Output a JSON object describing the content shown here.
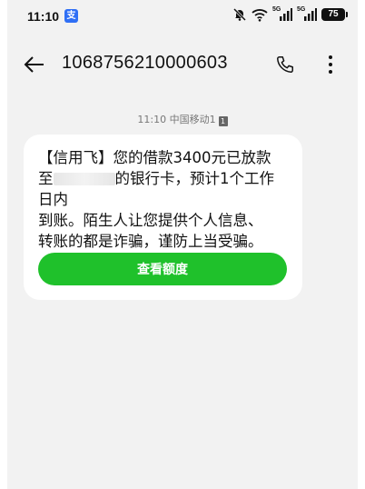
{
  "status_bar": {
    "time": "11:10",
    "app_badge": "支",
    "signal_tag_1": "5G",
    "signal_tag_2": "5G",
    "battery": "75"
  },
  "header": {
    "title": "1068756210000603"
  },
  "conversation": {
    "meta_time": "11:10 中国移动1",
    "sim_badge": "1",
    "message": {
      "line1": "【信用飞】您的借款3400元已放款",
      "line2_prefix": "至",
      "line2_suffix": "的银行卡，预计1个工作日内",
      "line3": "到账。陌生人让您提供个人信息、",
      "line4": "转账的都是诈骗，谨防上当受骗。",
      "button_label": "查看额度"
    }
  },
  "colors": {
    "background": "#f2f2f2",
    "bubble": "#ffffff",
    "button": "#1fc12b"
  },
  "icons": {
    "back": "arrow-left-icon",
    "call": "phone-icon",
    "more": "more-vertical-icon",
    "mute": "bell-off-icon",
    "wifi": "wifi-icon"
  }
}
